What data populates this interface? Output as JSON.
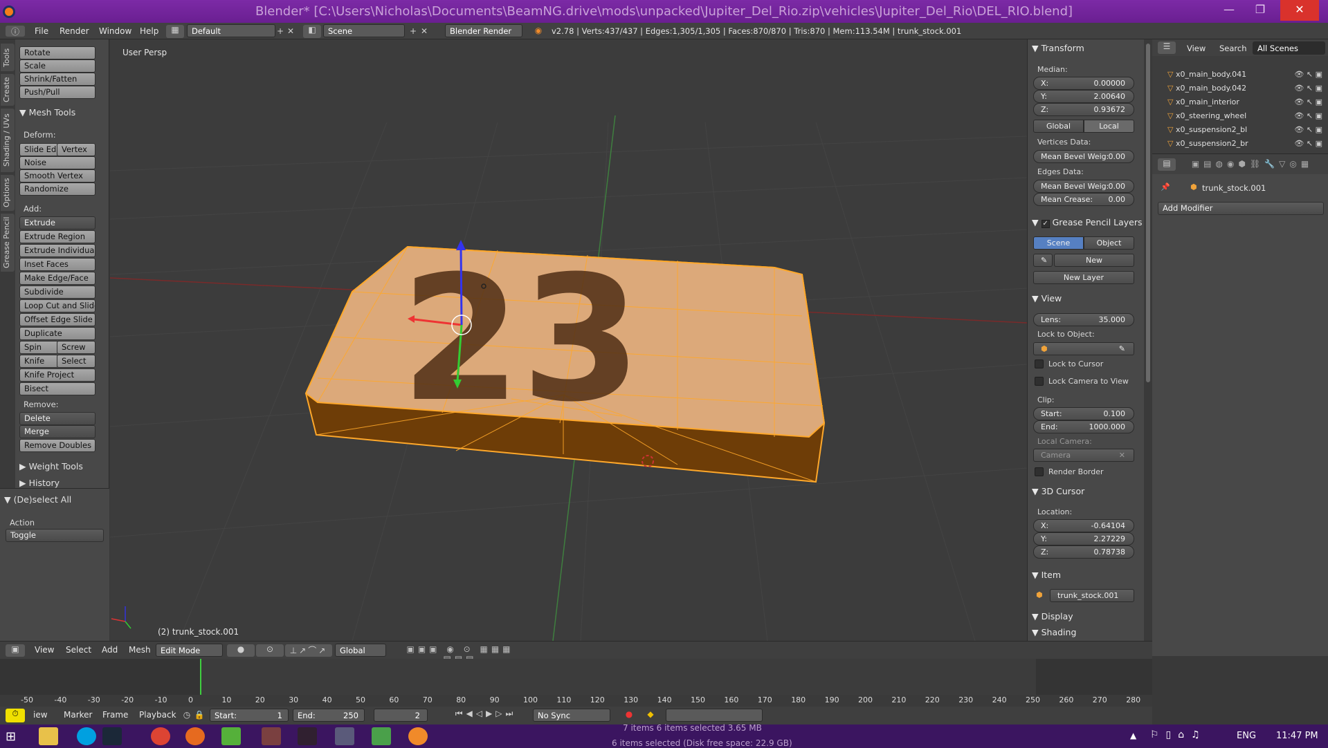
{
  "window": {
    "title": "Blender* [C:\\Users\\Nicholas\\Documents\\BeamNG.drive\\mods\\unpacked\\Jupiter_Del_Rio.zip\\vehicles\\Jupiter_Del_Rio\\DEL_RIO.blend]",
    "min": "—",
    "max": "❐",
    "close": "✕"
  },
  "info": {
    "menus": [
      "File",
      "Render",
      "Window",
      "Help"
    ],
    "layout": "Default",
    "scene": "Scene",
    "engine": "Blender Render",
    "stats": "v2.78 | Verts:437/437 | Edges:1,305/1,305 | Faces:870/870 | Tris:870 | Mem:113.54M | trunk_stock.001"
  },
  "lefttabs": [
    "Tools",
    "Create",
    "Shading / UVs",
    "Options",
    "Grease Pencil"
  ],
  "tools": {
    "top_buttons": [
      "Rotate",
      "Scale",
      "Shrink/Fatten",
      "Push/Pull"
    ],
    "mesh_tools": "Mesh Tools",
    "deform": "Deform:",
    "slide_edge": "Slide Ed",
    "vertex": "Vertex",
    "deform_buttons": [
      "Noise",
      "Smooth Vertex",
      "Randomize"
    ],
    "add": "Add:",
    "extrude": "Extrude",
    "add_buttons": [
      "Extrude Region",
      "Extrude Individual",
      "Inset Faces",
      "Make Edge/Face",
      "Subdivide",
      "Loop Cut and Slide",
      "Offset Edge Slide",
      "Duplicate"
    ],
    "spin": "Spin",
    "screw": "Screw",
    "knife": "Knife",
    "select": "Select",
    "knife_project": "Knife Project",
    "bisect": "Bisect",
    "remove": "Remove:",
    "delete": "Delete",
    "merge": "Merge",
    "remove_doubles": "Remove Doubles",
    "weight_tools": "Weight Tools",
    "history": "History",
    "op_title": "(De)select All",
    "action_label": "Action",
    "action_value": "Toggle"
  },
  "viewport": {
    "persp": "User Persp",
    "object": "(2) trunk_stock.001",
    "decal": "23"
  },
  "npanel": {
    "transform": "Transform",
    "median": "Median:",
    "x_label": "X:",
    "x_value": "0.00000",
    "y_label": "Y:",
    "y_value": "2.00640",
    "z_label": "Z:",
    "z_value": "0.93672",
    "global": "Global",
    "local": "Local",
    "vertices_data": "Vertices Data:",
    "mean_bevel_v": "Mean Bevel Weig:",
    "mean_bevel_v_val": "0.00",
    "edges_data": "Edges Data:",
    "mean_bevel_e": "Mean Bevel Weig:",
    "mean_bevel_e_val": "0.00",
    "mean_crease": "Mean Crease:",
    "mean_crease_val": "0.00",
    "grease": "Grease Pencil Layers",
    "scene": "Scene",
    "object": "Object",
    "new": "New",
    "new_layer": "New Layer",
    "view": "View",
    "lens": "Lens:",
    "lens_val": "35.000",
    "lock_obj": "Lock to Object:",
    "lock_cursor": "Lock to Cursor",
    "lock_camera": "Lock Camera to View",
    "clip": "Clip:",
    "start": "Start:",
    "start_val": "0.100",
    "end": "End:",
    "end_val": "1000.000",
    "local_camera": "Local Camera:",
    "camera": "Camera",
    "render_border": "Render Border",
    "cursor": "3D Cursor",
    "location": "Location:",
    "cx_label": "X:",
    "cx": "-0.64104",
    "cy_label": "Y:",
    "cy": "2.27229",
    "cz_label": "Z:",
    "cz": "0.78738",
    "item": "Item",
    "item_name": "trunk_stock.001",
    "display": "Display",
    "shading": "Shading"
  },
  "outliner": {
    "view": "View",
    "search": "Search",
    "filter": "All Scenes",
    "items": [
      "x0_main_body.041",
      "x0_main_body.042",
      "x0_main_interior",
      "x0_steering_wheel",
      "x0_suspension2_bl",
      "x0_suspension2_br"
    ]
  },
  "props": {
    "object": "trunk_stock.001",
    "add_modifier": "Add Modifier"
  },
  "v3header": {
    "menus": [
      "View",
      "Select",
      "Add",
      "Mesh"
    ],
    "mode": "Edit Mode",
    "orientation": "Global"
  },
  "timeline": {
    "ticks": [
      "-50",
      "-40",
      "-30",
      "-20",
      "-10",
      "0",
      "10",
      "20",
      "30",
      "40",
      "50",
      "60",
      "70",
      "80",
      "90",
      "100",
      "110",
      "120",
      "130",
      "140",
      "150",
      "160",
      "170",
      "180",
      "190",
      "200",
      "210",
      "220",
      "230",
      "240",
      "250",
      "260",
      "270",
      "280"
    ],
    "menus": [
      "iew",
      "Marker",
      "Frame",
      "Playback"
    ],
    "start": "Start:",
    "start_val": "1",
    "end": "End:",
    "end_val": "250",
    "current": "2",
    "sync": "No Sync"
  },
  "taskbar": {
    "explorer_text1": "7 items     6 items selected  3.65 MB",
    "explorer_text2": "6 items selected (Disk free space: 22.9 GB)",
    "lang": "ENG",
    "time": "11:47 PM"
  }
}
